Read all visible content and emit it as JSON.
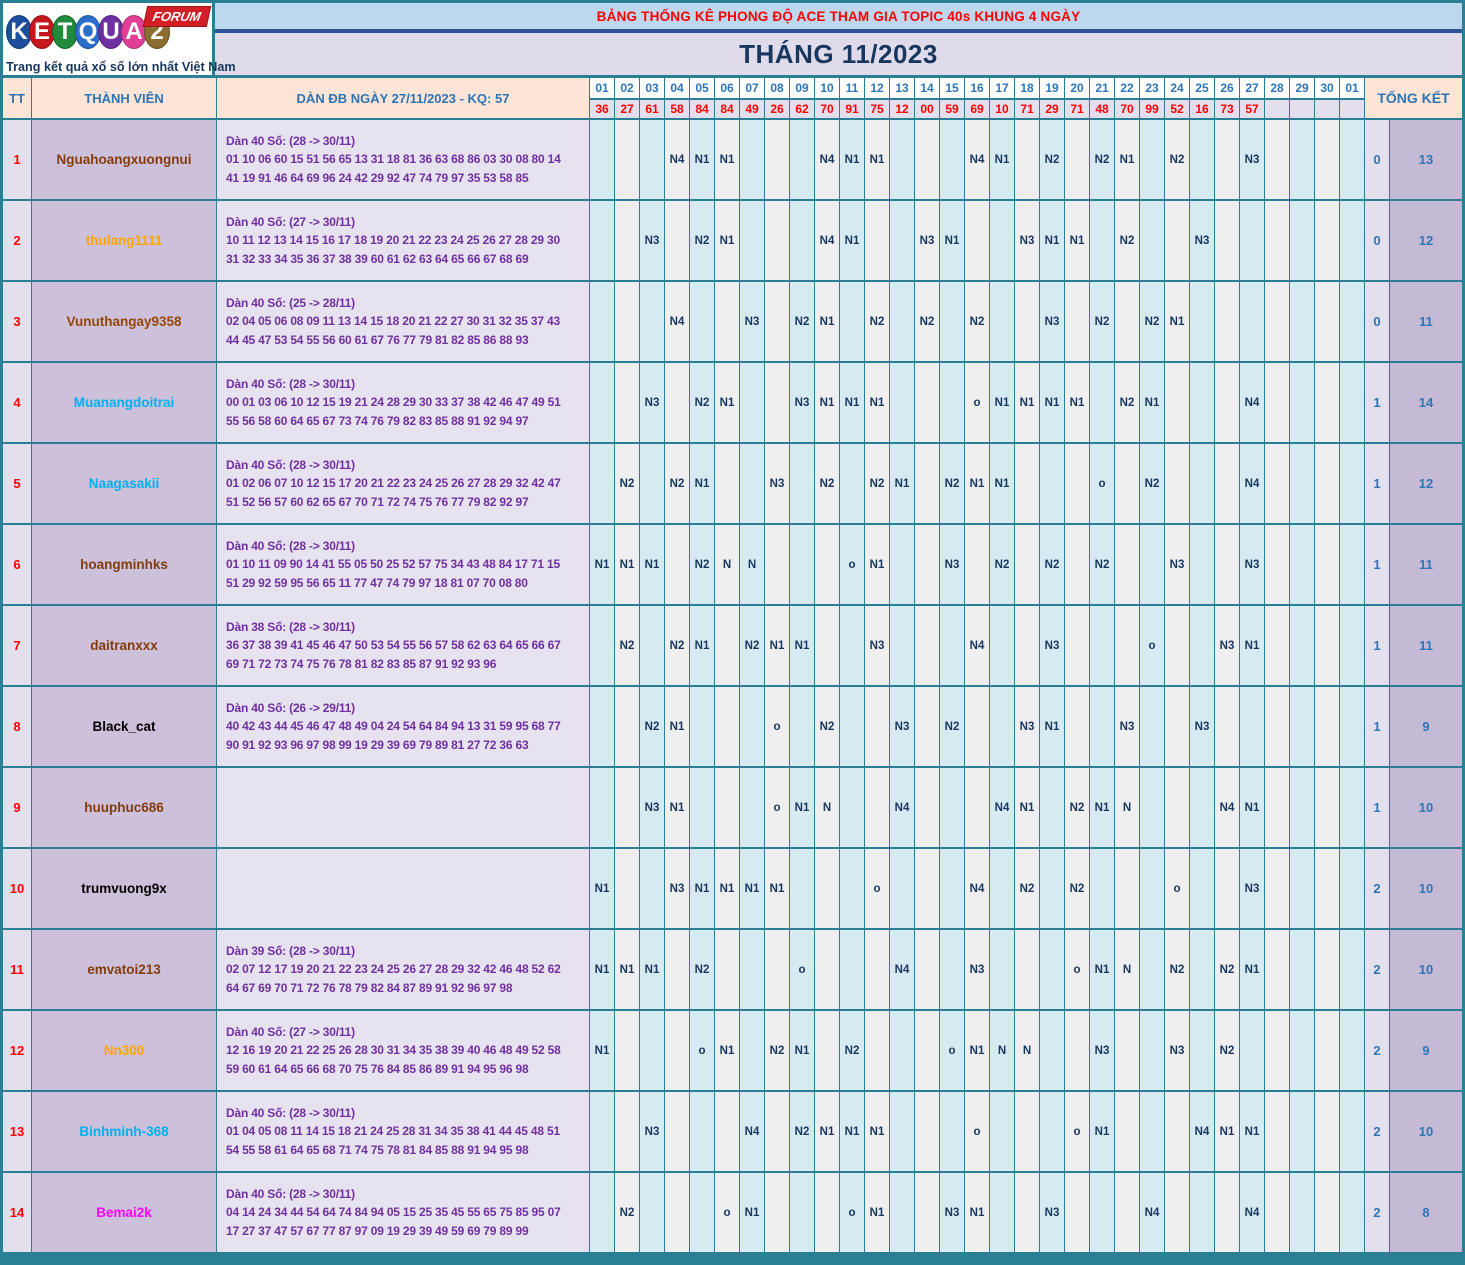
{
  "logo": {
    "brand": "KETQUA2",
    "letters": [
      {
        "ch": "K",
        "bg": "#1D4E9E"
      },
      {
        "ch": "E",
        "bg": "#C4161C"
      },
      {
        "ch": "T",
        "bg": "#1F8A3B"
      },
      {
        "ch": "Q",
        "bg": "#2A6FC9"
      },
      {
        "ch": "U",
        "bg": "#6E2FA0"
      },
      {
        "ch": "A",
        "bg": "#E23E96"
      },
      {
        "ch": "2",
        "bg": "#8A6D2F"
      }
    ],
    "forum": "FORUM",
    "tagline": "Trang kết quả xổ số lớn nhất Việt Nam"
  },
  "header": {
    "top_title": "BẢNG THỐNG KÊ PHONG ĐỘ ACE THAM GIA TOPIC 40s KHUNG 4 NGÀY",
    "month_title": "THÁNG 11/2023"
  },
  "colors": {
    "frame_teal": "#2B7F95",
    "band_blue": "#BDD7EE",
    "band_lavender": "#E0DBEA",
    "divider_navy": "#2F5496",
    "header_peach": "#FCE4D6",
    "header_blue": "#2E75B6",
    "title_navy": "#17375E",
    "kq_red": "#FF0000",
    "dan_purple": "#7030A0",
    "col_odd_blue": "#D6EAF2",
    "col_even_gray": "#EFEFEF",
    "tt_bg": "#E4DFEC",
    "member_bg": "#CCC0DA",
    "total_bg": "#C5BAD6"
  },
  "table": {
    "col_tt": "TT",
    "col_member": "THÀNH VIÊN",
    "col_dan": "DÀN ĐB NGÀY 27/11/2023 - KQ: 57",
    "col_total": "TỔNG KẾT",
    "days": [
      "01",
      "02",
      "03",
      "04",
      "05",
      "06",
      "07",
      "08",
      "09",
      "10",
      "11",
      "12",
      "13",
      "14",
      "15",
      "16",
      "17",
      "18",
      "19",
      "20",
      "21",
      "22",
      "23",
      "24",
      "25",
      "26",
      "27",
      "28",
      "29",
      "30",
      "01"
    ],
    "kq": [
      "36",
      "27",
      "61",
      "58",
      "84",
      "84",
      "49",
      "26",
      "62",
      "70",
      "91",
      "75",
      "12",
      "00",
      "59",
      "69",
      "10",
      "71",
      "29",
      "71",
      "48",
      "70",
      "99",
      "52",
      "16",
      "73",
      "57",
      "",
      "",
      "",
      ""
    ],
    "members": [
      {
        "tt": "1",
        "name": "Nguahoangxuongnui",
        "color": "#843C0C",
        "dan_title": "Dàn 40 Số: (28 -> 30/11)",
        "dan_line1": "01 10 06 60 15 51 56 65 13 31 18 81 36 63 68 86 03 30 08 80 14",
        "dan_line2": "41 19 91 46 64 69 96 24 42 29 92 47 74 79 97 35 53 58 85",
        "cells": {
          "4": "N4",
          "5": "N1",
          "6": "N1",
          "10": "N4",
          "11": "N1",
          "12": "N1",
          "16": "N4",
          "17": "N1",
          "19": "N2",
          "21": "N2",
          "22": "N1",
          "24": "N2",
          "27": "N3"
        },
        "total_left": "0",
        "total_right": "13"
      },
      {
        "tt": "2",
        "name": "thulang1111",
        "color": "#FFA500",
        "dan_title": "Dàn 40 Số: (27 -> 30/11)",
        "dan_line1": "10 11 12 13 14 15 16 17 18 19 20 21 22 23 24 25 26 27 28 29 30",
        "dan_line2": "31 32 33 34 35 36 37 38 39 60 61 62 63 64 65 66 67 68 69",
        "cells": {
          "3": "N3",
          "5": "N2",
          "6": "N1",
          "10": "N4",
          "11": "N1",
          "14": "N3",
          "15": "N1",
          "18": "N3",
          "19": "N1",
          "20": "N1",
          "22": "N2",
          "25": "N3"
        },
        "total_left": "0",
        "total_right": "12"
      },
      {
        "tt": "3",
        "name": "Vunuthangay9358",
        "color": "#974806",
        "dan_title": "Dàn 40 Số: (25 -> 28/11)",
        "dan_line1": "02 04 05 06 08 09 11 13 14 15 18 20 21 22 27 30 31 32 35 37 43",
        "dan_line2": "44 45 47 53 54 55 56 60 61 67 76 77 79 81 82 85 86 88 93",
        "cells": {
          "4": "N4",
          "7": "N3",
          "9": "N2",
          "10": "N1",
          "12": "N2",
          "14": "N2",
          "16": "N2",
          "19": "N3",
          "21": "N2",
          "23": "N2",
          "24": "N1"
        },
        "total_left": "0",
        "total_right": "11"
      },
      {
        "tt": "4",
        "name": "Muanangdoitrai",
        "color": "#00B0F0",
        "dan_title": "Dàn 40 Số: (28 -> 30/11)",
        "dan_line1": "00 01 03 06 10 12 15 19 21 24 28 29 30 33 37 38 42 46 47 49 51",
        "dan_line2": "55 56 58 60 64 65 67 73 74 76 79 82 83 85 88 91 92 94 97",
        "cells": {
          "3": "N3",
          "5": "N2",
          "6": "N1",
          "9": "N3",
          "10": "N1",
          "11": "N1",
          "12": "N1",
          "16": "o",
          "17": "N1",
          "18": "N1",
          "19": "N1",
          "20": "N1",
          "22": "N2",
          "23": "N1",
          "27": "N4"
        },
        "total_left": "1",
        "total_right": "14"
      },
      {
        "tt": "5",
        "name": "Naagasakii",
        "color": "#00B0F0",
        "dan_title": "Dàn 40 Số: (28 -> 30/11)",
        "dan_line1": "01 02 06 07 10 12 15 17 20 21 22 23 24 25 26 27 28 29 32 42 47",
        "dan_line2": "51 52 56 57 60 62 65 67 70 71 72 74 75 76 77 79 82 92 97",
        "cells": {
          "2": "N2",
          "4": "N2",
          "5": "N1",
          "8": "N3",
          "10": "N2",
          "12": "N2",
          "13": "N1",
          "15": "N2",
          "16": "N1",
          "17": "N1",
          "21": "o",
          "23": "N2",
          "27": "N4"
        },
        "total_left": "1",
        "total_right": "12"
      },
      {
        "tt": "6",
        "name": "hoangminhks",
        "color": "#843C0C",
        "dan_title": "Dàn 40 Số: (28 -> 30/11)",
        "dan_line1": "01 10 11 09 90 14 41 55 05 50 25 52 57 75 34 43 48 84 17 71 15",
        "dan_line2": "51 29 92 59 95 56 65 11 77 47 74 79 97 18 81 07 70 08 80",
        "cells": {
          "1": "N1",
          "2": "N1",
          "3": "N1",
          "5": "N2",
          "6": "N",
          "7": "N",
          "11": "o",
          "12": "N1",
          "15": "N3",
          "17": "N2",
          "19": "N2",
          "21": "N2",
          "24": "N3",
          "27": "N3"
        },
        "total_left": "1",
        "total_right": "11"
      },
      {
        "tt": "7",
        "name": "daitranxxx",
        "color": "#843C0C",
        "dan_title": "Dàn 38 Số: (28 -> 30/11)",
        "dan_line1": "36 37 38 39 41 45 46 47 50 53 54 55 56 57 58 62 63 64 65 66 67",
        "dan_line2": "69 71 72 73 74 75 76 78 81 82 83 85 87 91 92 93 96",
        "cells": {
          "2": "N2",
          "4": "N2",
          "5": "N1",
          "7": "N2",
          "8": "N1",
          "9": "N1",
          "12": "N3",
          "16": "N4",
          "19": "N3",
          "23": "o",
          "26": "N3",
          "27": "N1"
        },
        "total_left": "1",
        "total_right": "11"
      },
      {
        "tt": "8",
        "name": "Black_cat",
        "color": "#000000",
        "dan_title": "Dàn 40 Số: (26 -> 29/11)",
        "dan_line1": "40 42 43 44 45 46 47 48 49 04 24 54 64 84 94 13 31 59 95 68 77",
        "dan_line2": "90 91 92 93 96 97 98 99 19 29 39 69 79 89 81 27 72 36 63",
        "cells": {
          "3": "N2",
          "4": "N1",
          "8": "o",
          "10": "N2",
          "13": "N3",
          "15": "N2",
          "18": "N3",
          "19": "N1",
          "22": "N3",
          "25": "N3"
        },
        "total_left": "1",
        "total_right": "9"
      },
      {
        "tt": "9",
        "name": "huuphuc686",
        "color": "#843C0C",
        "dan_title": "",
        "dan_line1": "",
        "dan_line2": "",
        "cells": {
          "3": "N3",
          "4": "N1",
          "8": "o",
          "9": "N1",
          "10": "N",
          "13": "N4",
          "17": "N4",
          "18": "N1",
          "20": "N2",
          "21": "N1",
          "22": "N",
          "26": "N4",
          "27": "N1"
        },
        "total_left": "1",
        "total_right": "10"
      },
      {
        "tt": "10",
        "name": "trumvuong9x",
        "color": "#000000",
        "dan_title": "",
        "dan_line1": "",
        "dan_line2": "",
        "cells": {
          "1": "N1",
          "4": "N3",
          "5": "N1",
          "6": "N1",
          "7": "N1",
          "8": "N1",
          "12": "o",
          "16": "N4",
          "18": "N2",
          "20": "N2",
          "24": "o",
          "27": "N3"
        },
        "total_left": "2",
        "total_right": "10"
      },
      {
        "tt": "11",
        "name": "emvatoi213",
        "color": "#843C0C",
        "dan_title": "Dàn 39 Số: (28 -> 30/11)",
        "dan_line1": "02 07 12 17 19 20 21 22 23 24 25 26 27 28 29 32 42 46 48 52 62",
        "dan_line2": "64 67 69 70 71 72 76 78 79 82 84 87 89 91 92 96 97 98",
        "cells": {
          "1": "N1",
          "2": "N1",
          "3": "N1",
          "5": "N2",
          "9": "o",
          "13": "N4",
          "16": "N3",
          "20": "o",
          "21": "N1",
          "22": "N",
          "24": "N2",
          "26": "N2",
          "27": "N1"
        },
        "total_left": "2",
        "total_right": "10"
      },
      {
        "tt": "12",
        "name": "Nn300",
        "color": "#FFA500",
        "dan_title": "Dàn 40 Số: (27 -> 30/11)",
        "dan_line1": "12 16 19 20 21 22 25 26 28 30 31 34 35 38 39 40 46 48 49 52 58",
        "dan_line2": "59 60 61 64 65 66 68 70 75 76 84 85 86 89 91 94 95 96 98",
        "cells": {
          "1": "N1",
          "5": "o",
          "6": "N1",
          "8": "N2",
          "9": "N1",
          "11": "N2",
          "15": "o",
          "16": "N1",
          "17": "N",
          "18": "N",
          "21": "N3",
          "24": "N3",
          "26": "N2"
        },
        "total_left": "2",
        "total_right": "9"
      },
      {
        "tt": "13",
        "name": "Binhminh-368",
        "color": "#00B0F0",
        "dan_title": "Dàn 40 Số: (28 -> 30/11)",
        "dan_line1": "01 04 05 08 11 14 15 18 21 24 25 28 31 34 35 38 41 44 45 48 51",
        "dan_line2": "54 55 58 61 64 65 68 71 74 75 78 81 84 85 88 91 94 95 98",
        "cells": {
          "3": "N3",
          "7": "N4",
          "9": "N2",
          "10": "N1",
          "11": "N1",
          "12": "N1",
          "16": "o",
          "20": "o",
          "21": "N1",
          "25": "N4",
          "26": "N1",
          "27": "N1"
        },
        "total_left": "2",
        "total_right": "10"
      },
      {
        "tt": "14",
        "name": "Bemai2k",
        "color": "#FF00FF",
        "dan_title": "Dàn 40 Số: (28 -> 30/11)",
        "dan_line1": "04 14 24 34 44 54 64 74 84 94 05 15 25 35 45 55 65 75 85 95 07",
        "dan_line2": "17 27 37 47 57 67 77 87 97 09 19 29 39 49 59 69 79 89 99",
        "cells": {
          "2": "N2",
          "6": "o",
          "7": "N1",
          "11": "o",
          "12": "N1",
          "15": "N3",
          "16": "N1",
          "19": "N3",
          "23": "N4",
          "27": "N4"
        },
        "total_left": "2",
        "total_right": "8"
      }
    ]
  }
}
